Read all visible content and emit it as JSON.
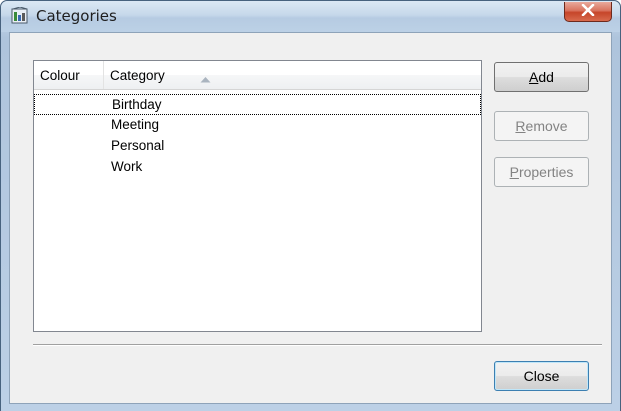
{
  "window": {
    "title": "Categories",
    "close_glyph": "X"
  },
  "listview": {
    "columns": [
      {
        "label": "Colour"
      },
      {
        "label": "Category",
        "sort": "ascending"
      }
    ],
    "rows": [
      {
        "colour": "",
        "category": "Birthday",
        "focused": true
      },
      {
        "colour": "",
        "category": "Meeting",
        "focused": false
      },
      {
        "colour": "",
        "category": "Personal",
        "focused": false
      },
      {
        "colour": "",
        "category": "Work",
        "focused": false
      }
    ]
  },
  "buttons": {
    "add": {
      "label": "Add",
      "accel": "A",
      "rest": "dd",
      "enabled": true
    },
    "remove": {
      "label": "Remove",
      "accel": "R",
      "rest": "emove",
      "enabled": false
    },
    "properties": {
      "label": "Properties",
      "accel": "P",
      "rest": "roperties",
      "enabled": false
    },
    "close": {
      "label": "Close",
      "enabled": true
    }
  },
  "colors": {
    "close_button": "#c6452a",
    "disabled_text": "#838383",
    "default_button_border": "#3c7fb1"
  },
  "icons": {
    "title": "categories-app-icon",
    "sort": "sort-ascending-arrow-icon",
    "close": "close-x-icon"
  }
}
